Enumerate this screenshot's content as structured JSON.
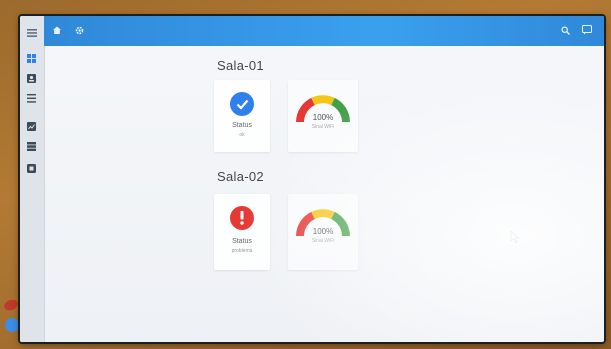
{
  "sidebar": {
    "items": [
      {
        "icon": "menu-icon"
      },
      {
        "icon": "dashboard-icon"
      },
      {
        "icon": "user-icon"
      },
      {
        "icon": "list-icon"
      },
      {
        "icon": "chart-icon"
      },
      {
        "icon": "storage-icon"
      },
      {
        "icon": "device-icon"
      }
    ]
  },
  "topbar": {
    "left_icons": [
      "home-icon",
      "settings-icon"
    ],
    "right_icons": [
      "search-icon",
      "chat-icon"
    ],
    "color": "#3396e4"
  },
  "rooms": [
    {
      "title": "Sala-01",
      "status": {
        "label": "Status",
        "value": "ok",
        "state": "ok",
        "color": "#2f80ed"
      },
      "gauge": {
        "value_text": "100%",
        "label": "Sinal WiFi",
        "level": 1.0
      }
    },
    {
      "title": "Sala-02",
      "status": {
        "label": "Status",
        "value": "problema",
        "state": "error",
        "color": "#e53935"
      },
      "gauge": {
        "value_text": "100%",
        "label": "Sinal WiFi",
        "level": 1.0
      }
    }
  ],
  "colors": {
    "gauge_low": "#e53935",
    "gauge_mid": "#f5c518",
    "gauge_high": "#43a047"
  }
}
